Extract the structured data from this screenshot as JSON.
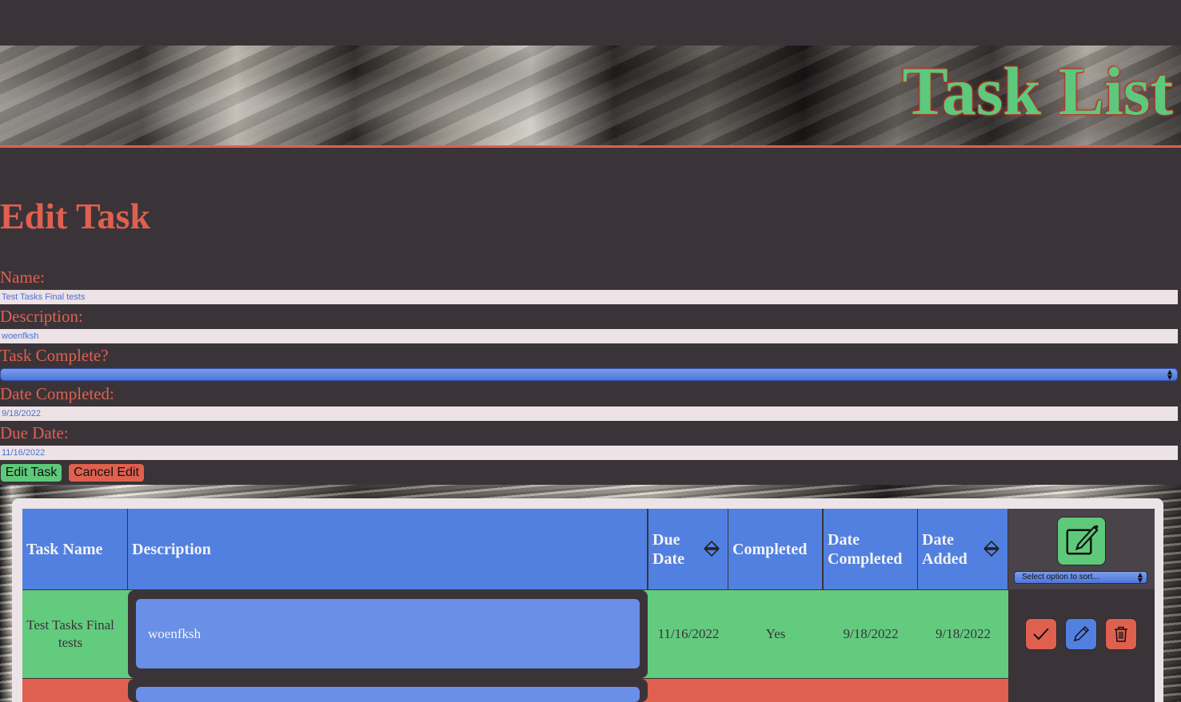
{
  "header": {
    "title": "Task List"
  },
  "page": {
    "title": "Edit Task"
  },
  "form": {
    "name_label": "Name:",
    "name_value": "Test Tasks Final tests",
    "description_label": "Description:",
    "description_value": "woenfksh",
    "complete_label": "Task Complete?",
    "complete_value": "",
    "date_completed_label": "Date Completed:",
    "date_completed_value": "9/18/2022",
    "due_date_label": "Due Date:",
    "due_date_value": "11/16/2022",
    "submit_label": "Edit Task",
    "cancel_label": "Cancel Edit"
  },
  "table": {
    "columns": {
      "task_name": "Task Name",
      "description": "Description",
      "due_date": "Due Date",
      "completed": "Completed",
      "date_completed": "Date Completed",
      "date_added": "Date Added"
    },
    "sort_placeholder": "Select option to sort...",
    "rows": [
      {
        "task_name": "Test Tasks Final tests",
        "description": "woenfksh",
        "due_date": "11/16/2022",
        "completed": "Yes",
        "date_completed": "9/18/2022",
        "date_added": "9/18/2022",
        "status_color": "#62cb7e"
      },
      {
        "task_name": "",
        "description": "",
        "due_date": "",
        "completed": "",
        "date_completed": "",
        "date_added": "",
        "status_color": "#e0604f"
      }
    ]
  },
  "colors": {
    "background": "#3a3439",
    "accent_red": "#e0604f",
    "accent_green": "#5ec97a",
    "accent_blue": "#5280e0"
  },
  "icons": {
    "add": "edit-square-icon",
    "sort": "sort-arrows-icon",
    "complete": "checkmark-icon",
    "edit": "pencil-icon",
    "delete": "trash-icon"
  }
}
